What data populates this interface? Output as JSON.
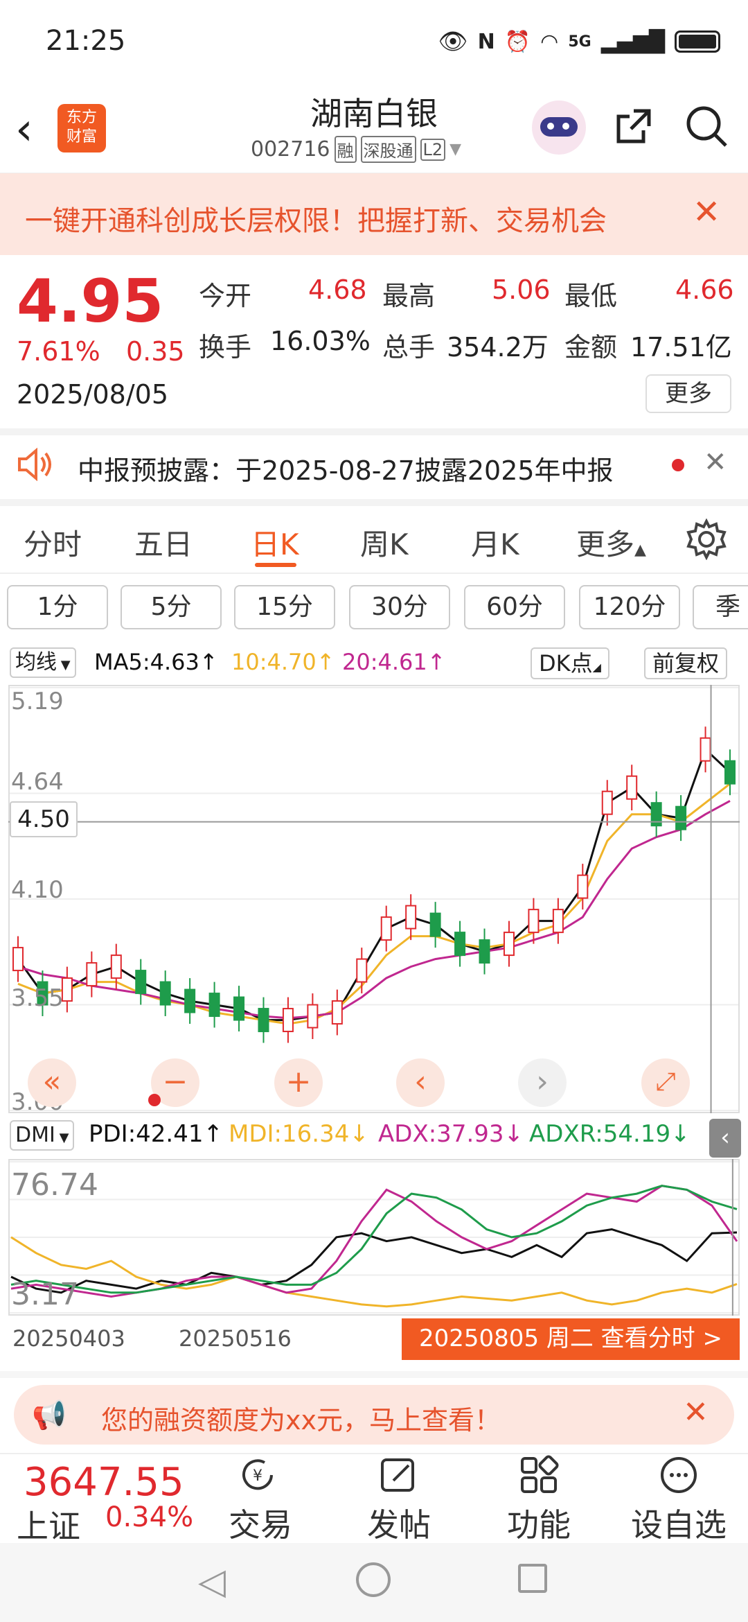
{
  "status_bar": {
    "time": "21:25",
    "network": "5G"
  },
  "header": {
    "logo_text": "东方财富",
    "stock_name": "湖南白银",
    "stock_code": "002716",
    "tags": [
      "融",
      "深股通",
      "L2"
    ]
  },
  "banner": {
    "text": "一键开通科创成长层权限！把握打新、交易机会"
  },
  "quote": {
    "price": "4.95",
    "change_pct": "7.61%",
    "change": "0.35",
    "date": "2025/08/05",
    "open_label": "今开",
    "open": "4.68",
    "high_label": "最高",
    "high": "5.06",
    "low_label": "最低",
    "low": "4.66",
    "turnover_label": "换手",
    "turnover": "16.03%",
    "volume_label": "总手",
    "volume": "354.2万",
    "amount_label": "金额",
    "amount": "17.51亿",
    "more_label": "更多"
  },
  "notice": {
    "text": "中报预披露：于2025-08-27披露2025年中报"
  },
  "tabs": [
    {
      "label": "分时"
    },
    {
      "label": "五日"
    },
    {
      "label": "日K"
    },
    {
      "label": "周K"
    },
    {
      "label": "月K"
    },
    {
      "label": "更多"
    }
  ],
  "intervals": [
    "1分",
    "5分",
    "15分",
    "30分",
    "60分",
    "120分",
    "季"
  ],
  "ma_bar": {
    "selector": "均线",
    "ma5": "MA5:4.63",
    "ma10": "10:4.70",
    "ma20": "20:4.61",
    "dk_label": "DK点",
    "adjust_label": "前复权"
  },
  "price_axis": {
    "top": "5.19",
    "upper": "4.64",
    "cursor": "4.50",
    "mid": "4.10",
    "lower": "3.55",
    "bottom": "3.00"
  },
  "dmi_bar": {
    "selector": "DMI",
    "pdi": "PDI:42.41",
    "mdi": "MDI:16.34",
    "adx": "ADX:37.93",
    "adxr": "ADXR:54.19"
  },
  "dmi_axis": {
    "top": "76.74",
    "bottom": "3.17"
  },
  "dates": {
    "start": "20250403",
    "mid": "20250516"
  },
  "date_badge": "20250805 周二 查看分时 >",
  "margin_notice": "您的融资额度为xx元，马上查看！",
  "index": {
    "value": "3647.55",
    "name": "上证",
    "change": "0.34%"
  },
  "bottom_nav": [
    {
      "label": "交易"
    },
    {
      "label": "发帖"
    },
    {
      "label": "功能"
    },
    {
      "label": "设自选"
    }
  ],
  "colors": {
    "up": "#e0292e",
    "down": "#1e9c4b",
    "accent": "#f15a22",
    "ma5": "#111111",
    "ma10": "#f0b429",
    "ma20": "#c0278f"
  },
  "chart_data": [
    {
      "type": "line",
      "title": "",
      "series": [
        {
          "name": "MA5",
          "values": [
            3.78,
            3.6,
            3.62,
            3.7,
            3.74,
            3.66,
            3.6,
            3.56,
            3.54,
            3.52,
            3.46,
            3.46,
            3.48,
            3.5,
            3.72,
            3.94,
            4.0,
            3.96,
            3.86,
            3.82,
            3.86,
            3.98,
            3.98,
            4.16,
            4.6,
            4.68,
            4.54,
            4.52,
            4.88,
            4.76
          ]
        },
        {
          "name": "MA10",
          "values": [
            3.65,
            3.6,
            3.62,
            3.66,
            3.66,
            3.6,
            3.56,
            3.54,
            3.5,
            3.48,
            3.46,
            3.44,
            3.46,
            3.52,
            3.64,
            3.8,
            3.9,
            3.9,
            3.86,
            3.84,
            3.86,
            3.92,
            3.96,
            4.1,
            4.4,
            4.54,
            4.54,
            4.5,
            4.6,
            4.7
          ]
        },
        {
          "name": "MA20",
          "values": [
            3.74,
            3.7,
            3.68,
            3.64,
            3.62,
            3.6,
            3.57,
            3.54,
            3.52,
            3.5,
            3.48,
            3.47,
            3.48,
            3.5,
            3.58,
            3.68,
            3.74,
            3.78,
            3.8,
            3.82,
            3.84,
            3.88,
            3.92,
            4.0,
            4.2,
            4.36,
            4.42,
            4.46,
            4.54,
            4.61
          ]
        }
      ],
      "ylim": [
        3.0,
        5.19
      ]
    },
    {
      "type": "line",
      "title": "",
      "series": [
        {
          "name": "PDI",
          "values": [
            20,
            14,
            12,
            18,
            16,
            14,
            18,
            16,
            22,
            20,
            16,
            18,
            26,
            40,
            42,
            38,
            40,
            36,
            32,
            34,
            30,
            36,
            30,
            42,
            44,
            40,
            36,
            28,
            42,
            42.41
          ]
        },
        {
          "name": "MDI",
          "values": [
            40,
            32,
            26,
            24,
            28,
            20,
            16,
            14,
            16,
            20,
            16,
            12,
            10,
            8,
            6,
            5,
            6,
            8,
            10,
            9,
            8,
            10,
            12,
            8,
            6,
            8,
            12,
            14,
            12,
            16.34
          ]
        },
        {
          "name": "ADX",
          "values": [
            14,
            16,
            14,
            12,
            10,
            12,
            14,
            18,
            20,
            20,
            16,
            12,
            14,
            28,
            48,
            64,
            58,
            48,
            40,
            34,
            38,
            46,
            54,
            62,
            60,
            58,
            66,
            64,
            56,
            37.93
          ]
        },
        {
          "name": "ADXR",
          "values": [
            16,
            18,
            16,
            14,
            12,
            12,
            14,
            16,
            18,
            20,
            18,
            16,
            16,
            22,
            34,
            52,
            62,
            60,
            54,
            44,
            40,
            42,
            48,
            56,
            60,
            62,
            66,
            64,
            58,
            54.19
          ]
        }
      ],
      "ylim": [
        3.17,
        76.74
      ]
    }
  ]
}
